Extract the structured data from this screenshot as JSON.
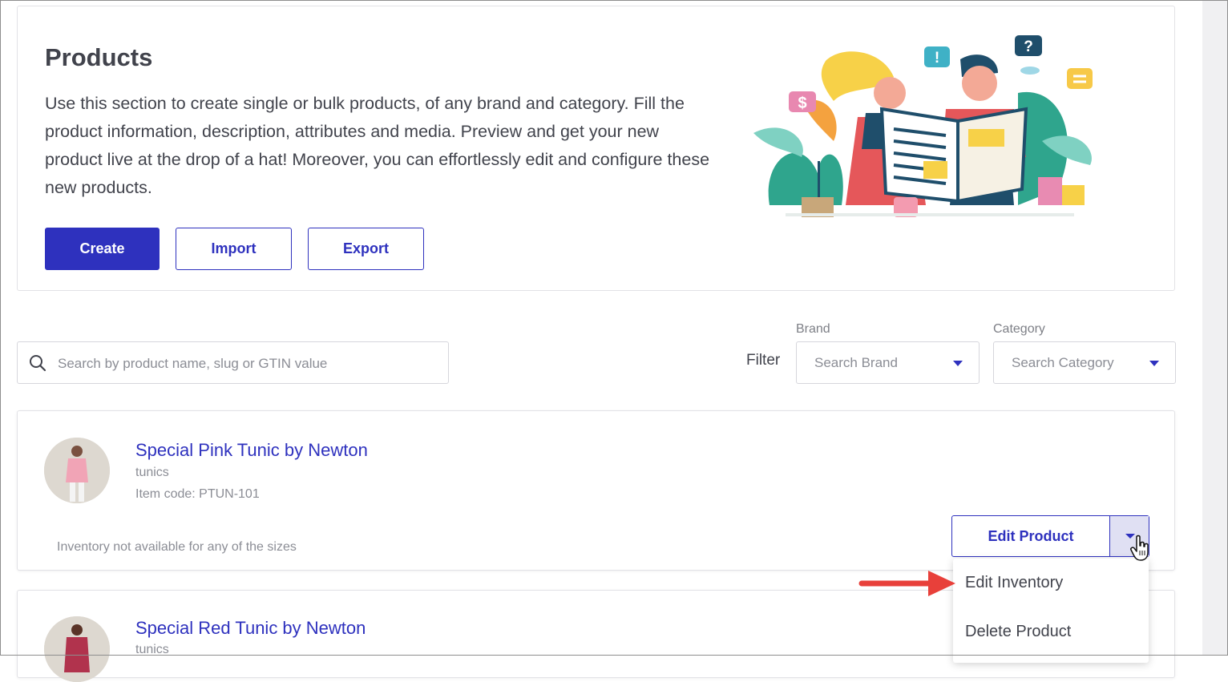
{
  "header": {
    "title": "Products",
    "description": "Use this section to create single or bulk products, of any brand and category. Fill the product information, description, attributes and media. Preview and get your new product live at the drop of a hat! Moreover, you can effortlessly edit and configure these new products.",
    "buttons": {
      "create": "Create",
      "import": "Import",
      "export": "Export"
    }
  },
  "illustration": {
    "dollar_glyph": "$",
    "exclamation_glyph": "!",
    "question_glyph": "?"
  },
  "search": {
    "placeholder": "Search by product name, slug or GTIN value",
    "value": ""
  },
  "filter": {
    "label": "Filter",
    "brand": {
      "label": "Brand",
      "placeholder": "Search Brand"
    },
    "category": {
      "label": "Category",
      "placeholder": "Search Category"
    }
  },
  "products": [
    {
      "title": "Special Pink Tunic by Newton",
      "category": "tunics",
      "item_code": "Item code: PTUN-101",
      "inventory_note": "Inventory not available for any of the sizes"
    },
    {
      "title": "Special Red Tunic by Newton",
      "category": "tunics"
    }
  ],
  "actions": {
    "edit_product": "Edit Product",
    "menu": {
      "edit_inventory": "Edit Inventory",
      "delete_product": "Delete Product"
    }
  },
  "colors": {
    "primary": "#2e31be",
    "annotation_arrow": "#e8403a",
    "text": "#41434c",
    "muted": "#8b8d95",
    "border": "#d6d6dc"
  }
}
